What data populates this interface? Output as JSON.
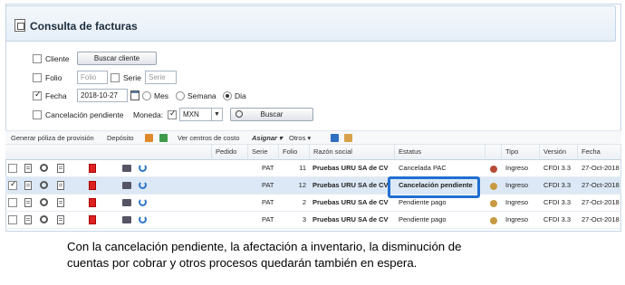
{
  "panel": {
    "title": "Consulta de facturas"
  },
  "filters": {
    "cliente_label": "Cliente",
    "buscar_cliente_label": "Buscar cliente",
    "folio_label": "Folio",
    "folio_placeholder": "Folio",
    "serie_label": "Serie",
    "serie_placeholder": "Serie",
    "fecha_label": "Fecha",
    "fecha_value": "2018-10-27",
    "mes_label": "Mes",
    "semana_label": "Semana",
    "dia_label": "Dia",
    "cancelacion_label": "Cancelación pendiente",
    "moneda_label": "Moneda:",
    "moneda_value": "MXN",
    "buscar_label": "Buscar"
  },
  "toolbar": {
    "poliza_label": "Generar póliza de provisión",
    "deposito_label": "Depósito",
    "centros_label": "Ver centros de costo",
    "asignar_label": "Asignar ▾",
    "otros_label": "Otros ▾"
  },
  "grid": {
    "columns": [
      "Pedido",
      "Serie",
      "Folio",
      "Razón social",
      "Estatus",
      "Tipo",
      "Versión",
      "Fecha"
    ],
    "rows": [
      {
        "serie": "PAT",
        "folio": "11",
        "razon": "Pruebas URU SA de CV",
        "estatus": "Cancelada PAC",
        "tipo": "Ingreso",
        "version": "CFDI 3.3",
        "fecha": "27-Oct-2018",
        "dot_color": "#b84a3a",
        "selected": false
      },
      {
        "serie": "PAT",
        "folio": "12",
        "razon": "Pruebas URU SA de CV",
        "estatus": "Cancelación pendiente",
        "tipo": "Ingreso",
        "version": "CFDI 3.3",
        "fecha": "27-Oct-2018",
        "dot_color": "#c79a42",
        "selected": true
      },
      {
        "serie": "PAT",
        "folio": "2",
        "razon": "Pruebas URU SA de CV",
        "estatus": "Pendiente pago",
        "tipo": "Ingreso",
        "version": "CFDI 3.3",
        "fecha": "27-Oct-2018",
        "dot_color": "#c79a42",
        "selected": false
      },
      {
        "serie": "PAT",
        "folio": "3",
        "razon": "Pruebas URU SA de CV",
        "estatus": "Pendiente pago",
        "tipo": "Ingreso",
        "version": "CFDI 3.3",
        "fecha": "27-Oct-2018",
        "dot_color": "#c79a42",
        "selected": false
      }
    ]
  },
  "caption": {
    "line1": "Con la cancelación pendiente, la afectación a inventario, la disminución de",
    "line2": "cuentas por cobrar y otros procesos quedarán también en espera."
  },
  "colors": {
    "highlight": "#1f6fd1",
    "selected_row": "#dce8f5"
  }
}
